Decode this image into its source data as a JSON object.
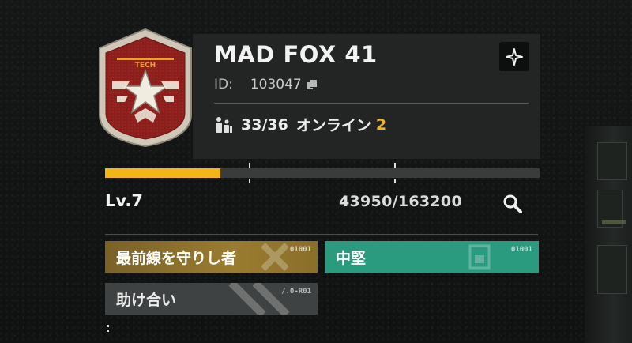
{
  "profile": {
    "name": "MAD FOX 41",
    "id_label": "ID:",
    "id_value": "103047",
    "members": "33/36",
    "online_label": "オンライン",
    "online_count": "2",
    "emblem_text": "TECH"
  },
  "level": {
    "label": "Lv.7",
    "exp_current": 43950,
    "exp_max": 163200,
    "exp_text": "43950/163200",
    "bar_fill_fraction": 0.265
  },
  "tags": [
    {
      "label": "最前線を守りし者",
      "code": "01001",
      "color": "#9a7c2f"
    },
    {
      "label": "中堅",
      "code": "01001",
      "color": "#2a9b7f"
    },
    {
      "label": "助け合い",
      "code": "/.0-R01",
      "color": "#3f4242"
    }
  ],
  "icons": {
    "corner": "crosshair-icon",
    "copy": "copy-icon",
    "members": "members-icon",
    "search": "search-icon",
    "emblem": "star-badge-icon"
  },
  "colors": {
    "accent_gold": "#f2b616",
    "online_orange": "#f0b429",
    "emblem_red": "#8a1f1f"
  }
}
